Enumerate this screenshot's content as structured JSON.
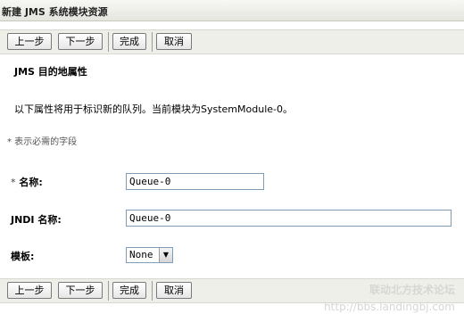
{
  "window": {
    "title": "新建 JMS 系统模块资源"
  },
  "toolbar": {
    "back_label": "上一步",
    "next_label": "下一步",
    "finish_label": "完成",
    "cancel_label": "取消"
  },
  "section": {
    "heading": "JMS 目的地属性",
    "intro": "以下属性将用于标识新的队列。当前模块为SystemModule-0。",
    "required_note": "* 表示必需的字段"
  },
  "form": {
    "name_required_marker": "*",
    "name_label": "名称:",
    "name_value": "Queue-0",
    "jndi_label": "JNDI 名称:",
    "jndi_value": "Queue-0",
    "template_label": "模板:",
    "template_value": "None"
  },
  "watermark": {
    "line1": "联动北方技术论坛",
    "line2": "http://bbs.landingbj.com"
  }
}
